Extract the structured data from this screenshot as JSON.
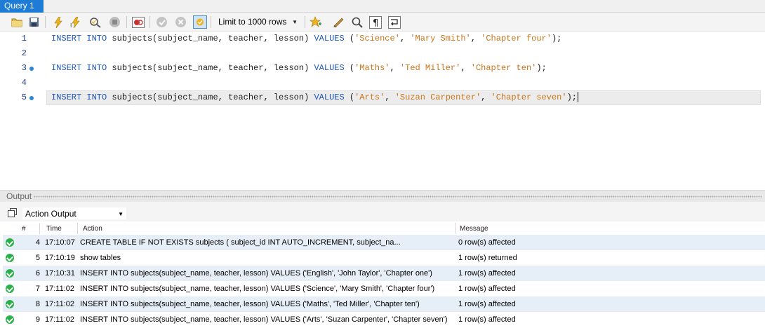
{
  "tab": {
    "title": "Query 1"
  },
  "toolbar": {
    "icons": [
      "open-file-icon",
      "save-icon",
      "execute-icon",
      "execute-current-icon",
      "explain-icon",
      "stop-icon",
      "toggle-error-icon",
      "commit-icon",
      "rollback-icon",
      "autocommit-icon",
      "add-snippet-icon",
      "beautify-icon",
      "find-icon",
      "invisible-chars-icon",
      "wrap-icon"
    ],
    "limit_label": "Limit to 1000 rows"
  },
  "editor": {
    "lines": [
      {
        "num": "1",
        "kw1": "INSERT INTO",
        "mid": " subjects(subject_name, teacher, lesson) ",
        "kw2": "VALUES",
        "open": " (",
        "v1": "'Science'",
        "c1": ", ",
        "v2": "'Mary Smith'",
        "c2": ", ",
        "v3": "'Chapter four'",
        "close": ");"
      },
      {
        "num": "2"
      },
      {
        "num": "3",
        "kw1": "INSERT INTO",
        "mid": " subjects(subject_name, teacher, lesson) ",
        "kw2": "VALUES",
        "open": " (",
        "v1": "'Maths'",
        "c1": ", ",
        "v2": "'Ted Miller'",
        "c2": ", ",
        "v3": "'Chapter ten'",
        "close": ");"
      },
      {
        "num": "4"
      },
      {
        "num": "5",
        "kw1": "INSERT INTO",
        "mid": " subjects(subject_name, teacher, lesson) ",
        "kw2": "VALUES",
        "open": " (",
        "v1": "'Arts'",
        "c1": ", ",
        "v2": "'Suzan Carpenter'",
        "c2": ", ",
        "v3": "'Chapter seven'",
        "close": ");"
      }
    ]
  },
  "output": {
    "title": "Output",
    "selector": "Action Output",
    "columns": {
      "num": "#",
      "time": "Time",
      "action": "Action",
      "message": "Message"
    },
    "rows": [
      {
        "num": "4",
        "time": "17:10:07",
        "action": "CREATE TABLE IF NOT EXISTS subjects (   subject_id INT AUTO_INCREMENT,                      subject_na...",
        "message": "0 row(s) affected"
      },
      {
        "num": "5",
        "time": "17:10:19",
        "action": "show tables",
        "message": "1 row(s) returned"
      },
      {
        "num": "6",
        "time": "17:10:31",
        "action": "INSERT INTO subjects(subject_name, teacher, lesson) VALUES ('English', 'John Taylor', 'Chapter one')",
        "message": "1 row(s) affected"
      },
      {
        "num": "7",
        "time": "17:11:02",
        "action": "INSERT INTO subjects(subject_name, teacher, lesson) VALUES ('Science', 'Mary Smith', 'Chapter four')",
        "message": "1 row(s) affected"
      },
      {
        "num": "8",
        "time": "17:11:02",
        "action": "INSERT INTO subjects(subject_name, teacher, lesson) VALUES ('Maths', 'Ted Miller', 'Chapter ten')",
        "message": "1 row(s) affected"
      },
      {
        "num": "9",
        "time": "17:11:02",
        "action": "INSERT INTO subjects(subject_name, teacher, lesson) VALUES ('Arts', 'Suzan Carpenter', 'Chapter seven')",
        "message": "1 row(s) affected"
      }
    ]
  },
  "colors": {
    "tab_active": "#1e7bd6",
    "keyword": "#1f57b8",
    "string": "#c7761d",
    "success": "#2bb14a",
    "row_alt": "#e6eef8"
  }
}
